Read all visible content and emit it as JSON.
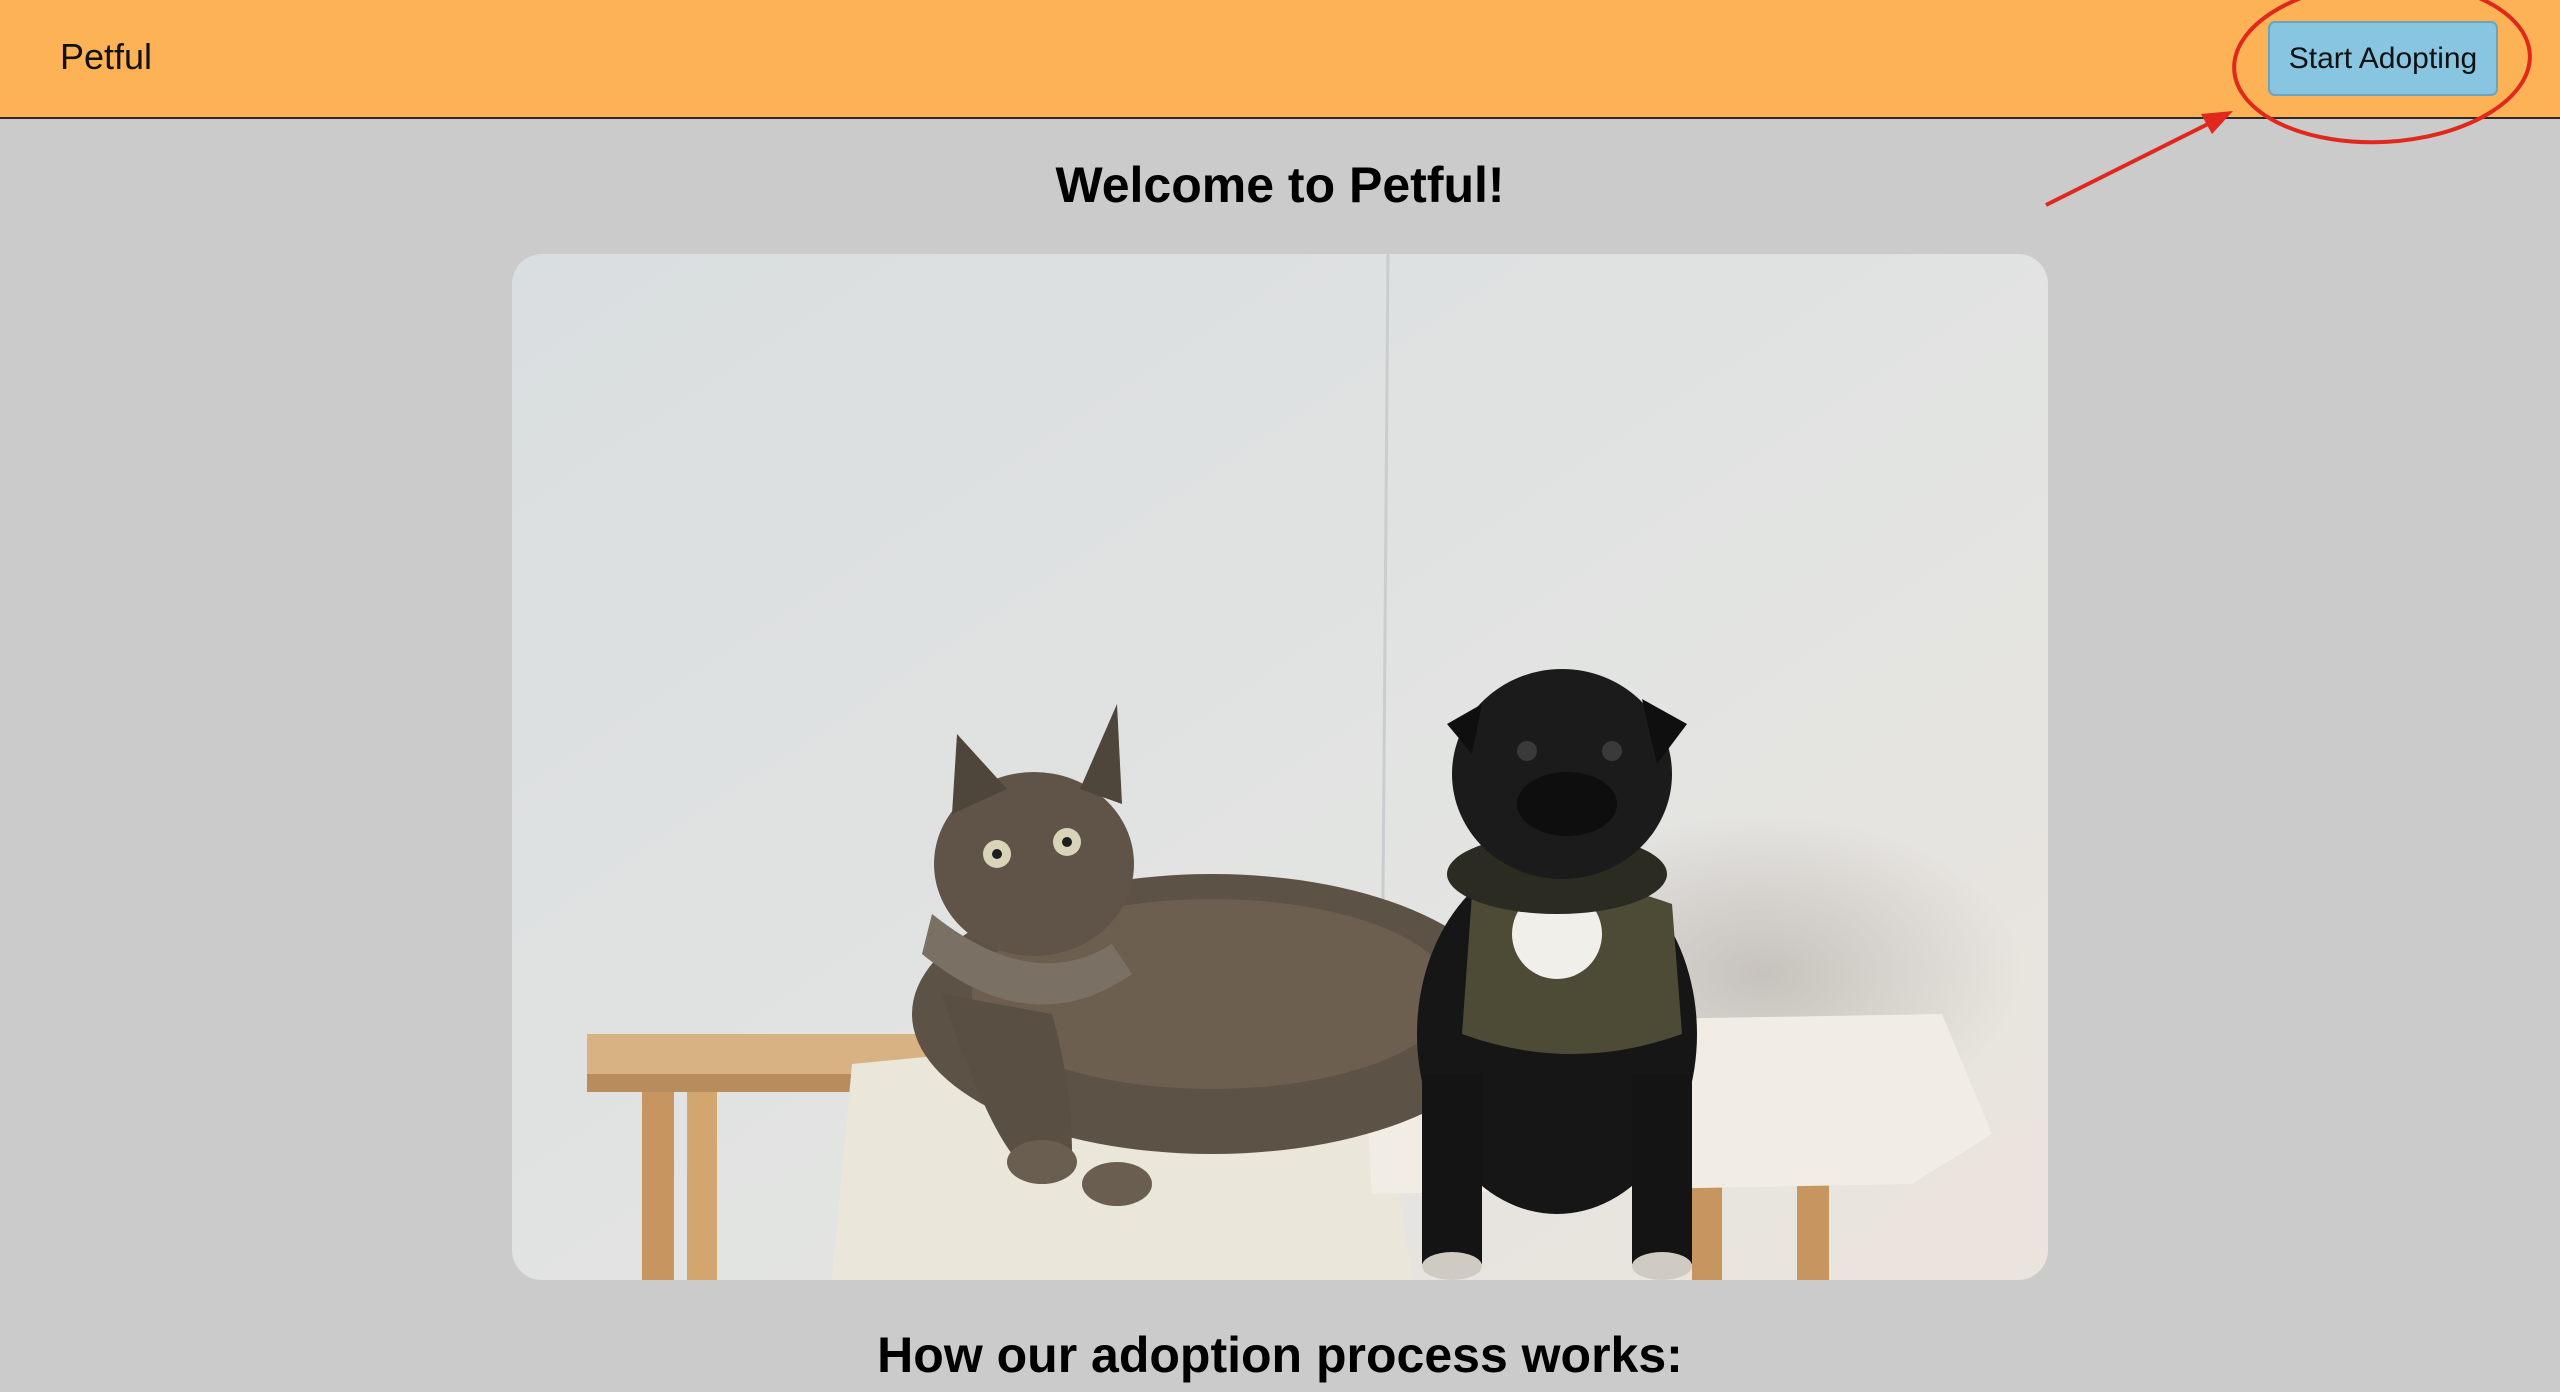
{
  "navbar": {
    "brand": "Petful",
    "start_button_label": "Start Adopting",
    "background": "#fdb355",
    "button_color": "#87c5e0"
  },
  "main": {
    "welcome_title": "Welcome to Petful!",
    "hero_image_icon": "cat-and-pug-photo",
    "process_heading": "How our adoption process works:"
  },
  "annotation": {
    "color": "#e0281c",
    "shapes": [
      "ellipse",
      "arrow"
    ]
  }
}
